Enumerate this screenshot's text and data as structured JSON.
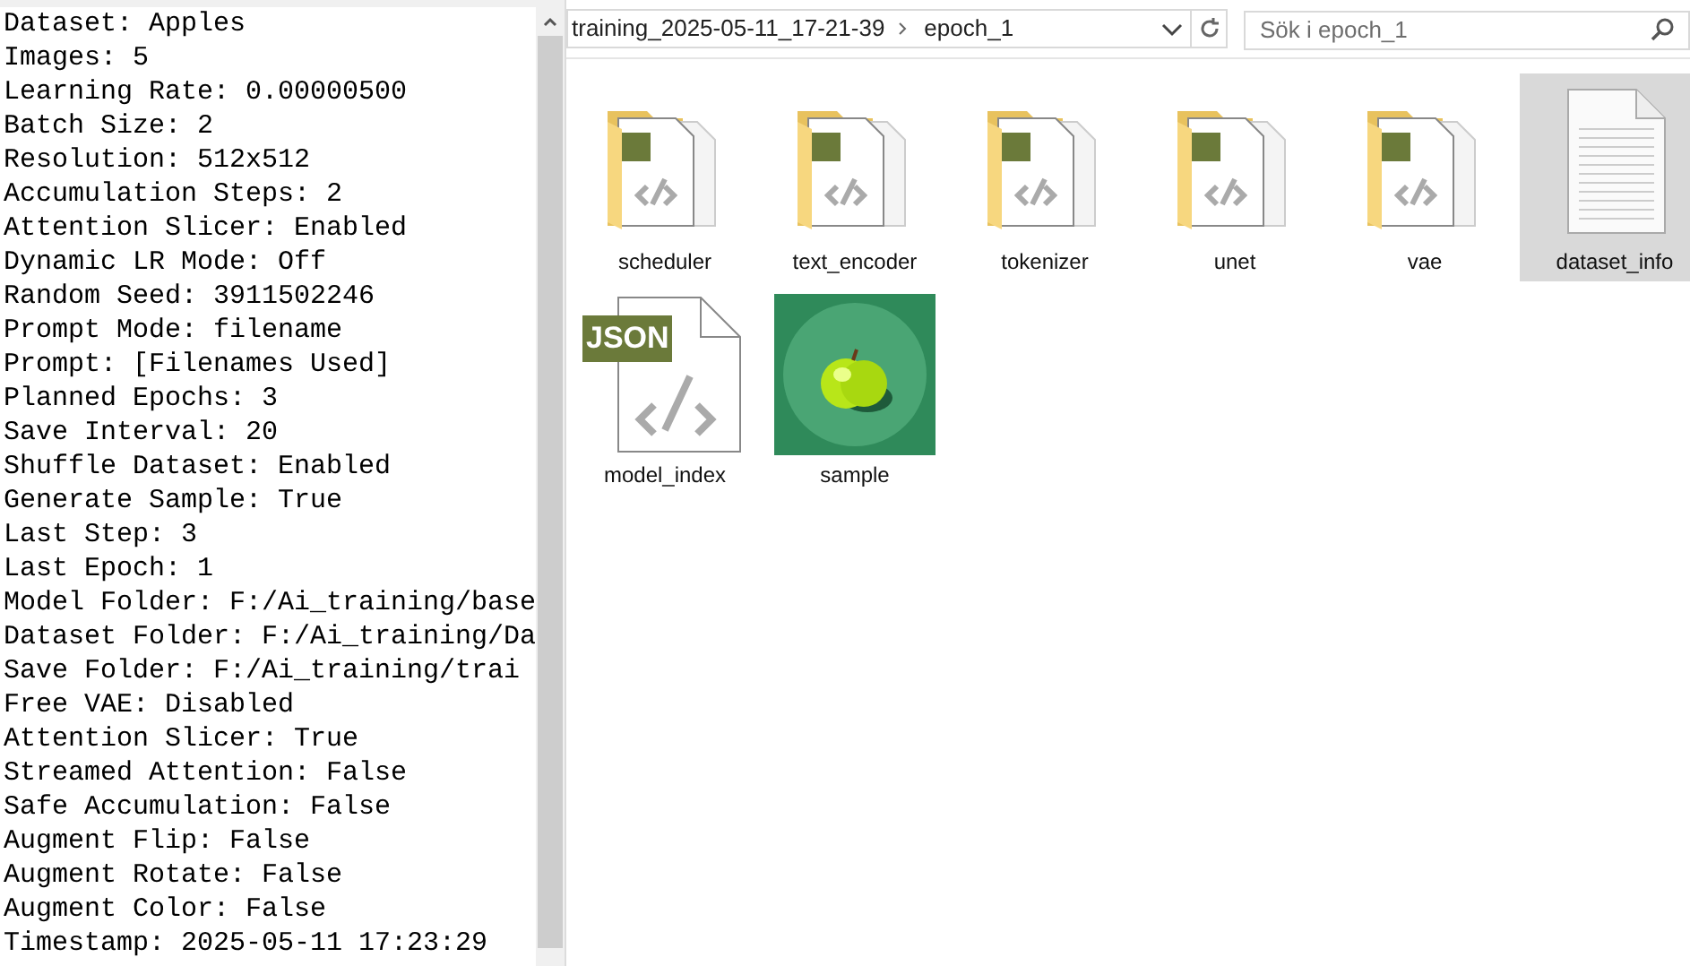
{
  "text_pane": {
    "lines": [
      "Dataset: Apples",
      "Images: 5",
      "Learning Rate: 0.00000500",
      "Batch Size: 2",
      "Resolution: 512x512",
      "Accumulation Steps: 2",
      "Attention Slicer: Enabled",
      "Dynamic LR Mode: Off",
      "Random Seed: 3911502246",
      "Prompt Mode: filename",
      "Prompt: [Filenames Used]",
      "Planned Epochs: 3",
      "Save Interval: 20",
      "Shuffle Dataset: Enabled",
      "Generate Sample: True",
      "Last Step: 3",
      "Last Epoch: 1",
      "Model Folder: F:/Ai_training/base",
      "Dataset Folder: F:/Ai_training/Da",
      "Save Folder: F:/Ai_training/trai",
      "Free VAE: Disabled",
      "Attention Slicer: True",
      "Streamed Attention: False",
      "Safe Accumulation: False",
      "Augment Flip: False",
      "Augment Rotate: False",
      "Augment Color: False",
      "Timestamp: 2025-05-11 17:23:29"
    ]
  },
  "address_bar": {
    "crumbs": [
      "training_2025-05-11_17-21-39",
      "epoch_1"
    ]
  },
  "search": {
    "placeholder": "Sök i epoch_1"
  },
  "files": [
    {
      "name": "scheduler",
      "kind": "folder",
      "selected": false
    },
    {
      "name": "text_encoder",
      "kind": "folder",
      "selected": false
    },
    {
      "name": "tokenizer",
      "kind": "folder",
      "selected": false
    },
    {
      "name": "unet",
      "kind": "folder",
      "selected": false
    },
    {
      "name": "vae",
      "kind": "folder",
      "selected": false
    },
    {
      "name": "dataset_info",
      "kind": "text",
      "selected": true
    },
    {
      "name": "model_index",
      "kind": "json",
      "badge": "JSON",
      "selected": false
    },
    {
      "name": "sample",
      "kind": "picture",
      "selected": false
    }
  ]
}
